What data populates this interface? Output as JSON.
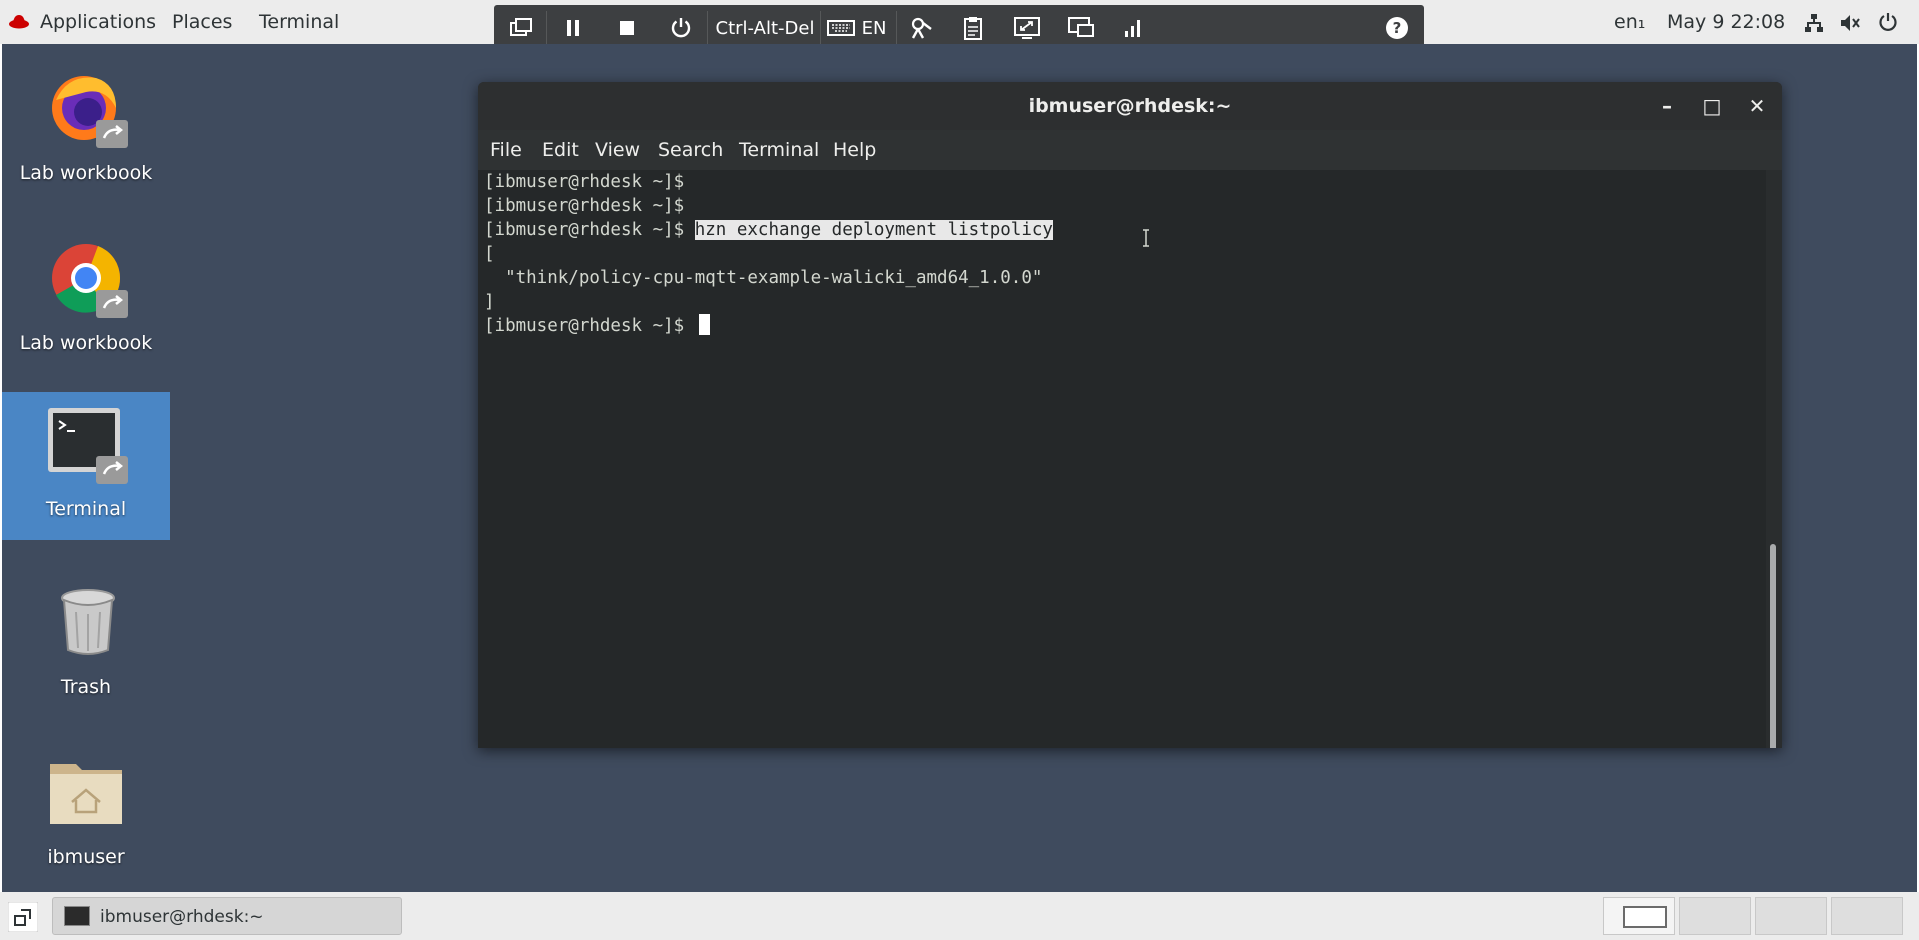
{
  "top_panel": {
    "applications": "Applications",
    "places": "Places",
    "terminal": "Terminal",
    "input_indicator": "en₁",
    "clock": "May 9  22:08",
    "icons": [
      "network-icon",
      "volume-icon",
      "power-icon"
    ]
  },
  "vm_toolbar": {
    "ctrl_alt_del": "Ctrl-Alt-Del",
    "keyboard_lang": "EN",
    "help": "?",
    "icons": [
      "switch-window-icon",
      "pause-icon",
      "stop-icon",
      "power-icon",
      "keyboard-icon",
      "macro-icon",
      "clipboard-icon",
      "resize-icon",
      "monitor-icon",
      "signal-icon",
      "help-icon"
    ]
  },
  "desktop": {
    "icons": [
      {
        "label": "Lab workbook",
        "icon": "firefox-icon"
      },
      {
        "label": "Lab workbook",
        "icon": "chrome-icon"
      },
      {
        "label": "Terminal",
        "icon": "terminal-icon"
      },
      {
        "label": "Trash",
        "icon": "trash-icon"
      },
      {
        "label": "ibmuser",
        "icon": "home-folder-icon"
      }
    ]
  },
  "terminal_window": {
    "title": "ibmuser@rhdesk:~",
    "controls": {
      "minimize": "–",
      "maximize": "□",
      "close": "✕"
    },
    "menu": [
      "File",
      "Edit",
      "View",
      "Search",
      "Terminal",
      "Help"
    ],
    "prompt": "[ibmuser@rhdesk ~]$ ",
    "command": "hzn exchange deployment listpolicy",
    "output": [
      "[",
      "  \"think/policy-cpu-mqtt-example-walicki_amd64_1.0.0\"",
      "]"
    ]
  },
  "taskbar": {
    "window_item": "ibmuser@rhdesk:~",
    "workspaces": 4,
    "active_workspace": 1
  },
  "colors": {
    "desktop_bg": "#3f4b5e",
    "terminal_bg": "#252829",
    "selection": "#4a86c5",
    "panel": "#ececec"
  }
}
